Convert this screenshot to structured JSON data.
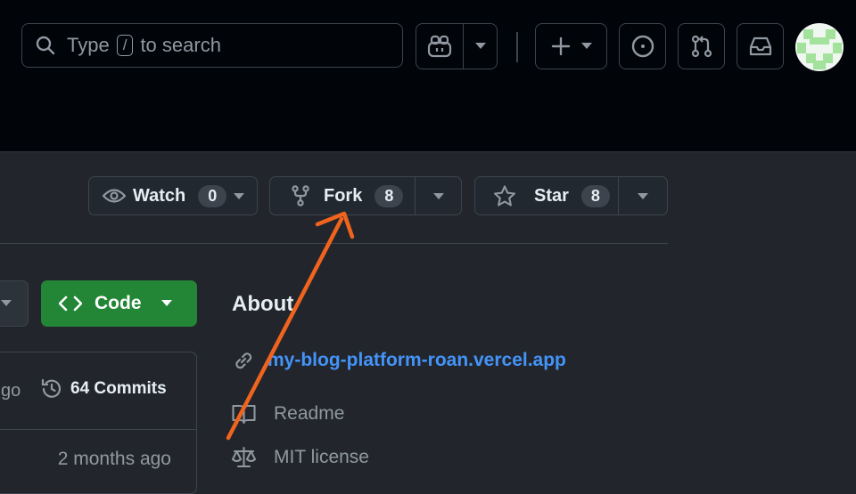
{
  "header": {
    "search_prefix": "Type",
    "search_key": "/",
    "search_suffix": "to search"
  },
  "repo_actions": {
    "watch": {
      "label": "Watch",
      "count": "0"
    },
    "fork": {
      "label": "Fork",
      "count": "8"
    },
    "star": {
      "label": "Star",
      "count": "8"
    }
  },
  "code_button": {
    "label": "Code"
  },
  "commits": {
    "ago_partial": "go",
    "count_label": "64 Commits",
    "last_time": "2 months ago"
  },
  "about": {
    "title": "About",
    "link": "my-blog-platform-roan.vercel.app",
    "readme": "Readme",
    "license": "MIT license"
  },
  "colors": {
    "accent_link": "#4493f8",
    "code_green": "#238636",
    "annotation_arrow": "#f0641e"
  }
}
